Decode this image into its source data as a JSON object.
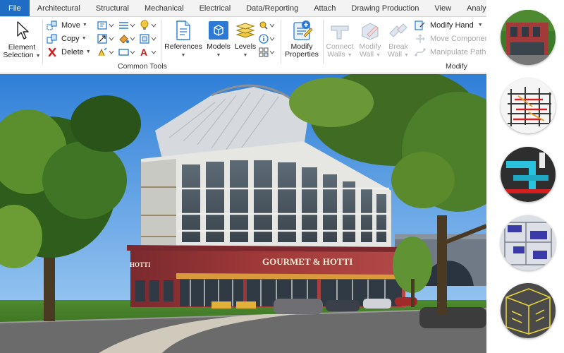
{
  "menu": {
    "tabs": [
      "File",
      "Architectural",
      "Structural",
      "Mechanical",
      "Electrical",
      "Data/Reporting",
      "Attach",
      "Drawing Production",
      "View",
      "Analysis"
    ]
  },
  "ribbon": {
    "element_selection": {
      "line1": "Element",
      "line2": "Selection"
    },
    "common_tools": {
      "move": "Move",
      "copy": "Copy",
      "delete": "Delete",
      "group_title": "Common Tools"
    },
    "references": "References",
    "models": "Models",
    "levels": "Levels",
    "modify_properties": {
      "line1": "Modify",
      "line2": "Properties"
    },
    "connect_walls": {
      "line1": "Connect",
      "line2": "Walls"
    },
    "modify_wall": {
      "line1": "Modify",
      "line2": "Wall"
    },
    "break_wall": {
      "line1": "Break",
      "line2": "Wall"
    },
    "modify_hand": "Modify Hand",
    "move_component": "Move Component",
    "manipulate_path": "Manipulate Path",
    "modify_group_title": "Modify"
  },
  "viewport": {
    "storefront_sign": "GOURMET & HOTTI",
    "side_sign": "HOTTI"
  },
  "thumbnails": [
    {
      "name": "rendered-building"
    },
    {
      "name": "structural-frame"
    },
    {
      "name": "mechanical-ducts"
    },
    {
      "name": "floor-plan-3d"
    },
    {
      "name": "wireframe-interior"
    }
  ],
  "colors": {
    "file_tab": "#1f6cc4",
    "brick": "#a23a3a",
    "sky": "#3d8fe0",
    "accent_blue": "#2b7bd6",
    "delete_red": "#d22020"
  }
}
